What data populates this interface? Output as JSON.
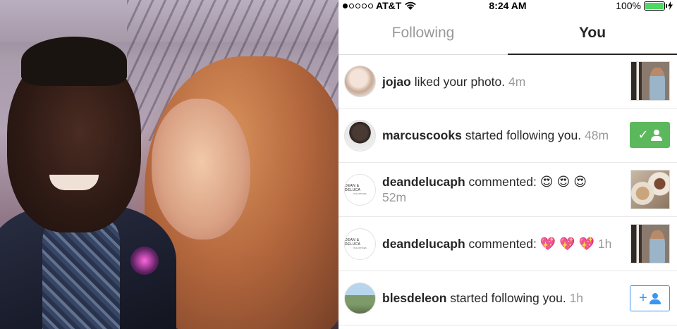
{
  "status_bar": {
    "carrier": "AT&T",
    "time": "8:24 AM",
    "battery": "100%",
    "signal_bars": 1,
    "icons": [
      "signal-dots-icon",
      "wifi-icon",
      "battery-icon",
      "charging-bolt-icon"
    ]
  },
  "tabs": [
    {
      "label": "Following",
      "active": false
    },
    {
      "label": "You",
      "active": true
    }
  ],
  "activity": [
    {
      "user": "jojao",
      "action": "liked your photo.",
      "time": "4m",
      "right": "photo-thumbnail"
    },
    {
      "user": "marcuscooks",
      "action": "started following you.",
      "time": "48m",
      "right": "following-button"
    },
    {
      "user": "deandelucaph",
      "action": "commented:",
      "comment": "😍 😍 😍",
      "time": "52m",
      "right": "photo-thumbnail"
    },
    {
      "user": "deandelucaph",
      "action": "commented:",
      "comment": "💖 💖 💖",
      "time": "1h",
      "right": "photo-thumbnail"
    },
    {
      "user": "blesdeleon",
      "action": "started following you.",
      "time": "1h",
      "right": "follow-button"
    }
  ],
  "avatar_logo": {
    "line1": "DEAN & DELUCA",
    "line2": "PHILIPPINES"
  },
  "colors": {
    "following_button": "#5cb85c",
    "follow_button": "#3897f0",
    "battery": "#4cd964",
    "inactive_tab": "#999999"
  }
}
